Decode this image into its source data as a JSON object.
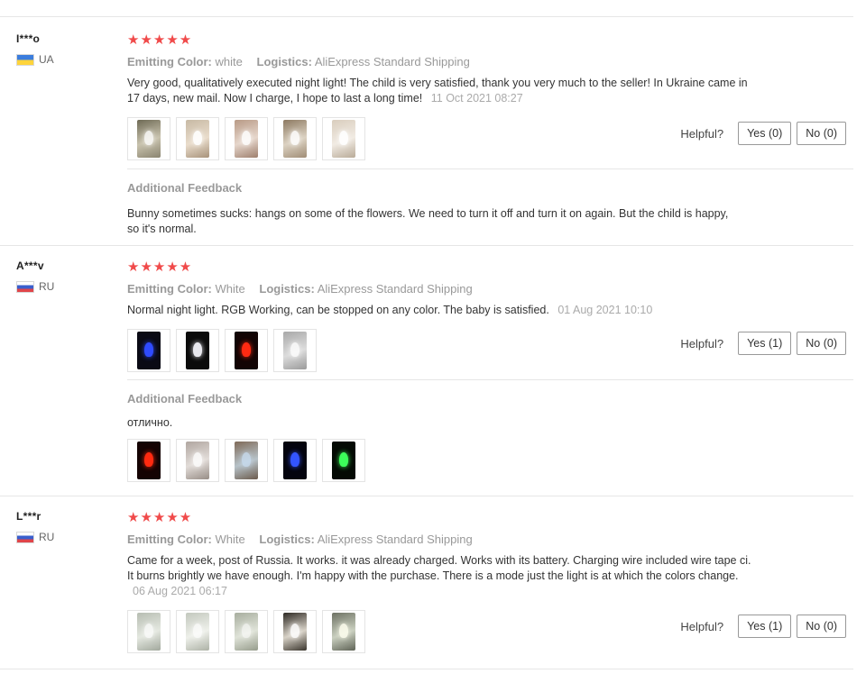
{
  "labels": {
    "emitting_color": "Emitting Color:",
    "logistics": "Logistics:",
    "helpful": "Helpful?",
    "additional_feedback": "Additional Feedback"
  },
  "colors": {
    "star": "#f04a4a",
    "flag_ua_top": "#3b7ddd",
    "flag_ua_bottom": "#ffd43b"
  },
  "reviews": [
    {
      "user": "I***o",
      "country": "UA",
      "stars": "★★★★★",
      "emitting_color": "white",
      "logistics": "AliExpress Standard Shipping",
      "text": "Very good, qualitatively executed night light! The child is very satisfied, thank you very much to the seller! In Ukraine came in 17 days, new mail. Now I charge, I hope to last a long time!",
      "date": "11 Oct 2021 08:27",
      "photo_count": 5,
      "yes": "Yes (0)",
      "no": "No (0)",
      "additional_text": "Bunny sometimes sucks: hangs on some of the flowers. We need to turn it off and turn it on again. But the child is happy, so it's normal."
    },
    {
      "user": "A***v",
      "country": "RU",
      "stars": "★★★★★",
      "emitting_color": "White",
      "logistics": "AliExpress Standard Shipping",
      "text": "Normal night light. RGB Working, can be stopped on any color. The baby is satisfied.",
      "date": "01 Aug 2021 10:10",
      "photo_count": 4,
      "yes": "Yes (1)",
      "no": "No (0)",
      "additional_text": "отлично.",
      "additional_photo_count": 5
    },
    {
      "user": "L***r",
      "country": "RU",
      "stars": "★★★★★",
      "emitting_color": "White",
      "logistics": "AliExpress Standard Shipping",
      "text": "Came for a week, post of Russia. It works. it was already charged. Works with its battery. Charging wire included wire tape ci. It burns brightly we have enough. I'm happy with the purchase. There is a mode just the light is at which the colors change.",
      "date": "06 Aug 2021 06:17",
      "photo_count": 5,
      "yes": "Yes (1)",
      "no": "No (0)"
    }
  ]
}
